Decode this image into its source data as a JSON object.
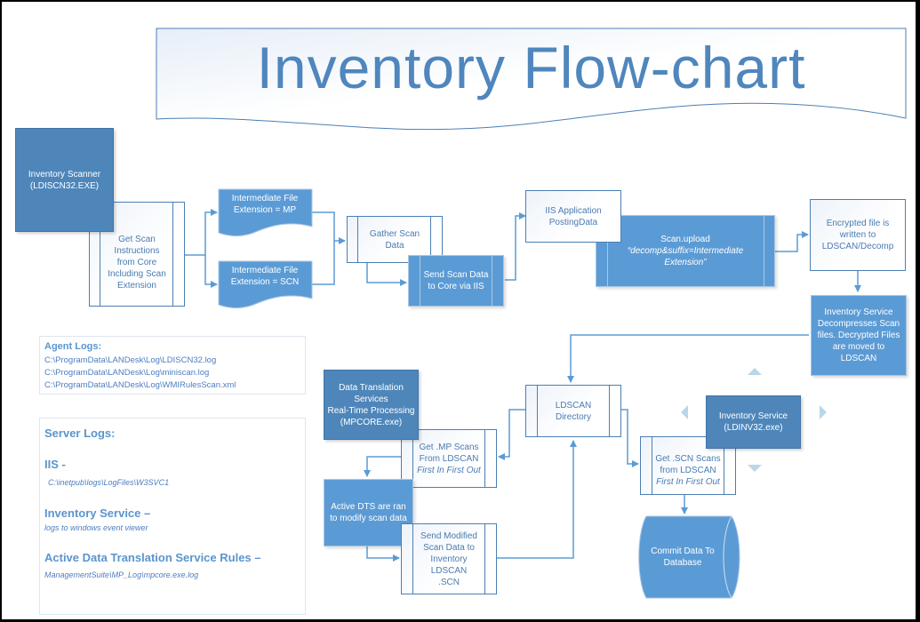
{
  "title": "Inventory Flow-chart",
  "colors": {
    "dark_fill": "#4e86ba",
    "mid_fill": "#5b9bd5",
    "light_text": "#4a7bb0",
    "connector": "#5b9bd5",
    "title_text": "#4f86bd"
  },
  "nodes": {
    "scanner": {
      "line1": "Inventory Scanner",
      "line2": "(LDISCN32.EXE)"
    },
    "get_scan_instructions": {
      "line1": "Get Scan",
      "line2": "Instructions",
      "line3": "from Core",
      "line4": "Including Scan",
      "line5": "Extension"
    },
    "file_mp": {
      "line1": "Intermediate File",
      "line2": "Extension = MP"
    },
    "file_scn": {
      "line1": "Intermediate File",
      "line2": "Extension = SCN"
    },
    "gather": {
      "line1": "Gather Scan",
      "line2": "Data"
    },
    "send_scan": {
      "line1": "Send Scan Data",
      "line2": "to Core via IIS"
    },
    "iis_app": {
      "line1": "IIS Application",
      "line2": "PostingData"
    },
    "scan_upload": {
      "line1": "Scan.upload",
      "line2": "“decomp&suffix=Intermediate",
      "line3": "Extension”"
    },
    "encrypted": {
      "line1": "Encrypted file is",
      "line2": "written to",
      "line3": "LDSCAN/Decomp"
    },
    "decompress": {
      "line1": "Inventory Service",
      "line2": "Decompresses Scan",
      "line3": "files. Decrypted Files",
      "line4": "are moved to",
      "line5": "LDSCAN"
    },
    "ldscan_dir": {
      "line1": "LDSCAN",
      "line2": "Directory"
    },
    "dts": {
      "line1": "Data Translation",
      "line2": "Services",
      "line3": "Real-Time Processing",
      "line4": "(MPCORE.exe)"
    },
    "get_mp": {
      "line1": "Get .MP Scans",
      "line2": "From LDSCAN",
      "line3": "First In First Out"
    },
    "active_dts": {
      "line1": "Active DTS are ran",
      "line2": "to modify scan data"
    },
    "send_modified": {
      "line1": "Send Modified",
      "line2": "Scan Data to",
      "line3": "Inventory",
      "line4": "LDSCAN",
      "line5": ".SCN"
    },
    "inv_service": {
      "line1": "Inventory Service",
      "line2": "(LDINV32.exe)"
    },
    "get_scn": {
      "line1": "Get .SCN Scans",
      "line2": "from LDSCAN",
      "line3": "First In First Out"
    },
    "commit_db": {
      "line1": "Commit Data To",
      "line2": "Database"
    }
  },
  "agent_logs": {
    "heading": "Agent Logs:",
    "paths": [
      "C:\\ProgramData\\LANDesk\\Log\\LDISCN32.log",
      "C:\\ProgramData\\LANDesk\\Log\\miniscan.log",
      "C:\\ProgramData\\LANDesk\\Log\\WMIRulesScan.xml"
    ]
  },
  "server_logs": {
    "heading": "Server Logs:",
    "iis_heading": "IIS -",
    "iis_path": "C:\\inetpub\\logs\\LogFiles\\W3SVC1",
    "inv_heading": "Inventory Service –",
    "inv_path": "logs to windows event viewer",
    "adts_heading": "Active Data Translation Service Rules –",
    "adts_path": "ManagementSuite\\MP_Log\\mpcore.exe.log"
  }
}
